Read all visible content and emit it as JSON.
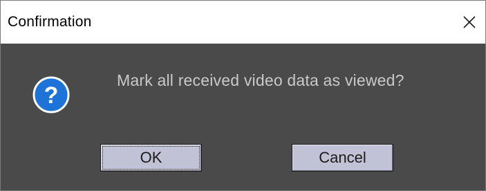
{
  "window": {
    "title": "Confirmation",
    "close_glyph": "✕"
  },
  "dialog": {
    "icon": "question-icon",
    "message": "Mark all received video data as viewed?",
    "ok_label": "OK",
    "cancel_label": "Cancel"
  },
  "colors": {
    "titlebar_bg": "#ffffff",
    "body_bg": "#4a4a4a",
    "message_text": "#c9c9c9",
    "button_bg": "#c2c2d6",
    "icon_blue": "#1e73d8"
  }
}
